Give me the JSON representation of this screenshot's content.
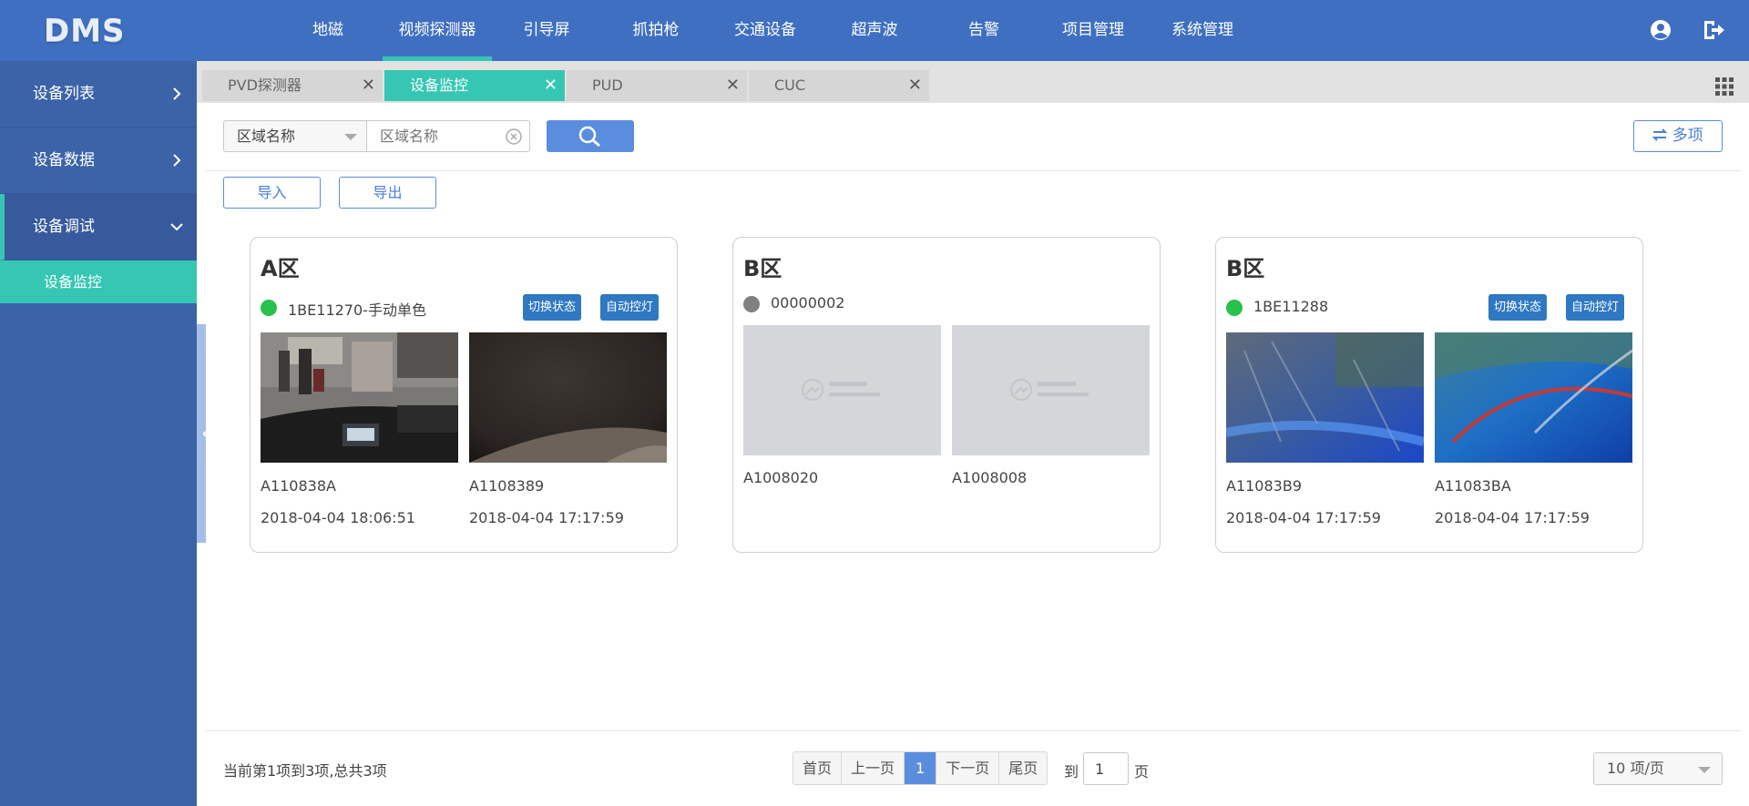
{
  "app": {
    "logo": "DMS"
  },
  "nav": [
    {
      "label": "地磁"
    },
    {
      "label": "视频探测器"
    },
    {
      "label": "引导屏"
    },
    {
      "label": "抓拍枪"
    },
    {
      "label": "交通设备"
    },
    {
      "label": "超声波"
    },
    {
      "label": "告警"
    },
    {
      "label": "项目管理"
    },
    {
      "label": "系统管理"
    }
  ],
  "nav_active_index": 1,
  "sidebar": {
    "items": [
      {
        "label": "设备列表"
      },
      {
        "label": "设备数据"
      },
      {
        "label": "设备调试"
      }
    ],
    "sub_item": "设备监控"
  },
  "tabs": [
    {
      "label": "PVD探测器"
    },
    {
      "label": "设备监控"
    },
    {
      "label": "PUD"
    },
    {
      "label": "CUC"
    }
  ],
  "filter": {
    "field_selected": "区域名称",
    "search_placeholder": "区域名称"
  },
  "buttons": {
    "multi": "多项",
    "import": "导入",
    "export": "导出"
  },
  "cards": [
    {
      "title": "A区",
      "device": "1BE11270-手动单色",
      "status": "online",
      "actions": [
        "切换状态",
        "自动控灯"
      ],
      "cameras": [
        {
          "id": "A110838A",
          "time": "2018-04-04 18:06:51"
        },
        {
          "id": "A1108389",
          "time": "2018-04-04 17:17:59"
        }
      ]
    },
    {
      "title": "B区",
      "device": "00000002",
      "status": "offline",
      "actions": [],
      "cameras": [
        {
          "id": "A1008020",
          "time": ""
        },
        {
          "id": "A1008008",
          "time": ""
        }
      ]
    },
    {
      "title": "B区",
      "device": "1BE11288",
      "status": "online",
      "actions": [
        "切换状态",
        "自动控灯"
      ],
      "cameras": [
        {
          "id": "A11083B9",
          "time": "2018-04-04 17:17:59"
        },
        {
          "id": "A11083BA",
          "time": "2018-04-04 17:17:59"
        }
      ]
    }
  ],
  "pagination": {
    "info": "当前第1项到3项,总共3项",
    "first": "首页",
    "prev": "上一页",
    "current": "1",
    "next": "下一页",
    "last": "尾页",
    "goto_prefix": "到",
    "goto_value": "1",
    "goto_suffix": "页",
    "page_size": "10 项/页"
  },
  "colors": {
    "topbar": "#3f6fc0",
    "accent": "#35c7b4",
    "primary_button": "#5b8dde",
    "status_online": "#27c14b",
    "status_offline": "#808080"
  },
  "icons": [
    "user-icon",
    "logout-icon",
    "chevron-right-icon",
    "chevron-down-icon",
    "close-icon",
    "grid-icon",
    "clear-icon",
    "search-icon",
    "swap-icon",
    "no-picture-icon"
  ]
}
